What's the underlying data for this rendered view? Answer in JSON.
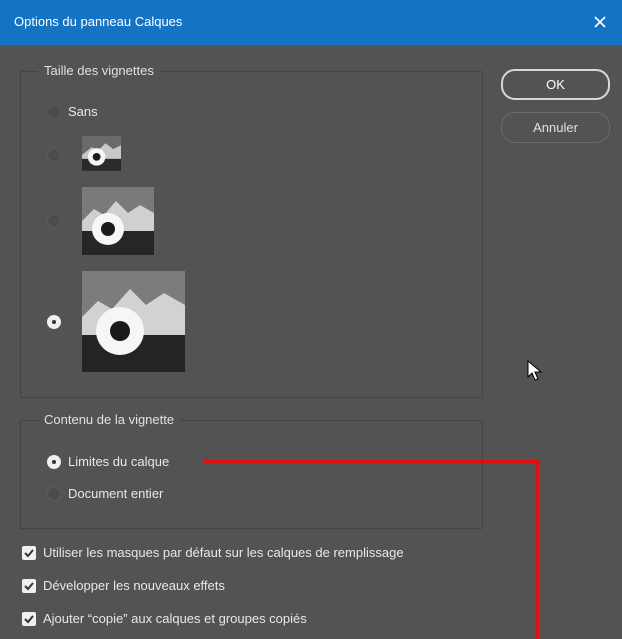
{
  "dialog": {
    "title": "Options du panneau Calques"
  },
  "thumbnail_size": {
    "legend": "Taille des vignettes",
    "none_label": "Sans",
    "selected": "large"
  },
  "thumbnail_content": {
    "legend": "Contenu de la vignette",
    "options": [
      "Limites du calque",
      "Document entier"
    ],
    "selected": "Limites du calque"
  },
  "buttons": {
    "ok": "OK",
    "cancel": "Annuler"
  },
  "checkboxes": [
    {
      "label": "Utiliser les masques par défaut sur les calques de remplissage",
      "checked": true
    },
    {
      "label": "Développer les nouveaux effets",
      "checked": true
    },
    {
      "label": "Ajouter “copie” aux calques et groupes copiés",
      "checked": true
    }
  ],
  "colors": {
    "titlebar": "#1573c3",
    "background": "#535353",
    "annotation": "#e01010"
  }
}
